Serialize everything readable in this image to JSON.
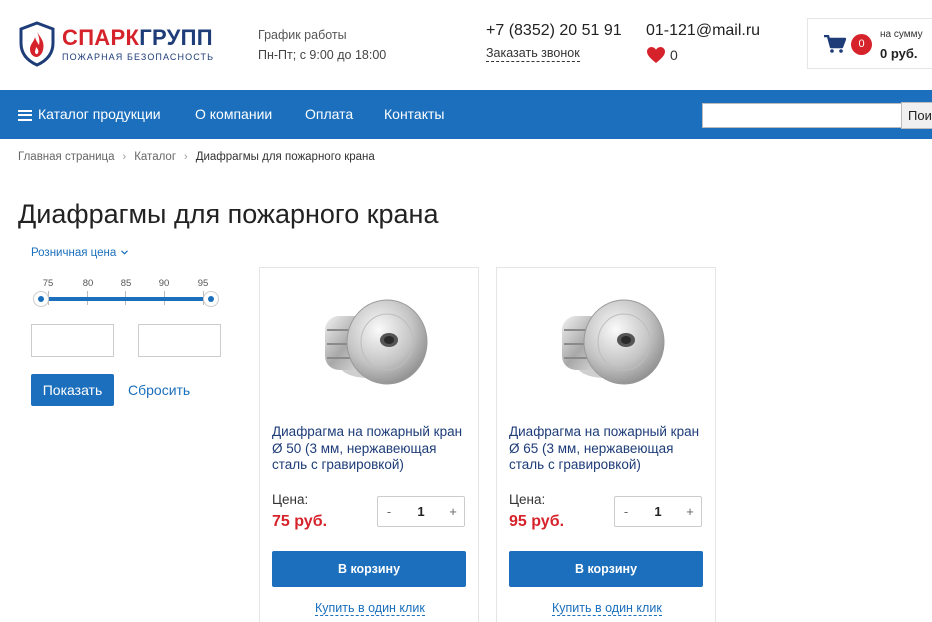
{
  "brand": {
    "name_part1": "СПАРК",
    "name_part2": "ГРУПП",
    "tagline": "ПОЖАРНАЯ БЕЗОПАСНОСТЬ",
    "colors": {
      "red": "#d6232b",
      "navy": "#1d3c78"
    }
  },
  "header": {
    "schedule_title": "График работы",
    "schedule_hours": "Пн-Пт; с 9:00 до 18:00",
    "phone": "+7 (8352) 20 51 91",
    "callback_link": "Заказать звонок",
    "email": "01-121@mail.ru",
    "favorites_count": "0",
    "cart": {
      "count": "0",
      "sum_label": "на сумму",
      "sum_value": "0 руб."
    }
  },
  "nav": {
    "catalog": "Каталог продукции",
    "items": [
      "О компании",
      "Оплата",
      "Контакты"
    ],
    "search_button": "Поиск",
    "accent": "#1b6fbc"
  },
  "breadcrumb": {
    "items": [
      "Главная страница",
      "Каталог"
    ],
    "current": "Диафрагмы для пожарного крана"
  },
  "page_title": "Диафрагмы для пожарного крана",
  "filter": {
    "price_toggle": "Розничная цена",
    "ticks": [
      "75",
      "80",
      "85",
      "90",
      "95"
    ],
    "range_min": 75,
    "range_max": 95,
    "show_button": "Показать",
    "reset_link": "Сбросить"
  },
  "products": [
    {
      "title": "Диафрагма на пожарный кран Ø 50 (3 мм, нержавеющая сталь с гравировкой)",
      "price_label": "Цена:",
      "price": "75 руб.",
      "qty_minus": "-",
      "qty": "1",
      "qty_plus": "+",
      "cart_button": "В корзину",
      "one_click": "Купить в один клик"
    },
    {
      "title": "Диафрагма на пожарный кран Ø 65 (3 мм, нержавеющая сталь с гравировкой)",
      "price_label": "Цена:",
      "price": "95 руб.",
      "qty_minus": "-",
      "qty": "1",
      "qty_plus": "+",
      "cart_button": "В корзину",
      "one_click": "Купить в один клик"
    }
  ]
}
